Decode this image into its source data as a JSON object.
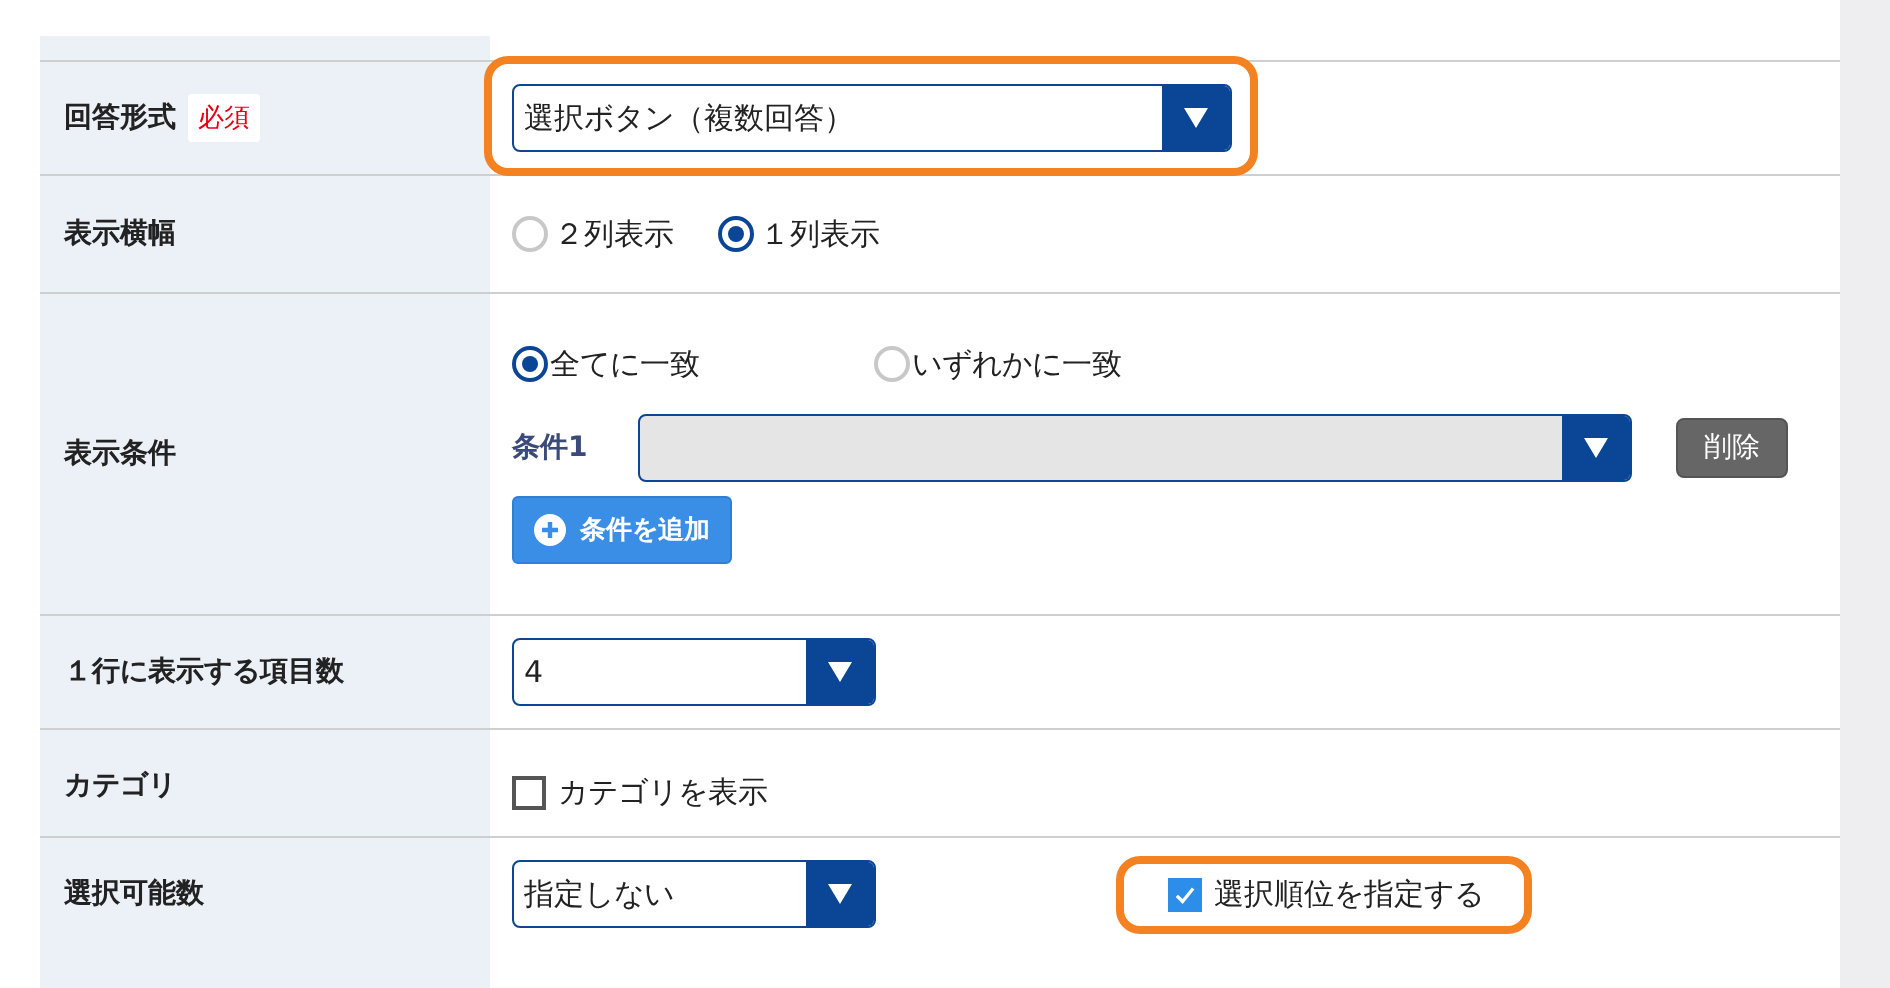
{
  "rows": [
    {
      "kind": "wide-select",
      "label": "回答形式",
      "required": "必須",
      "value": "選択ボタン（複数回答）",
      "highlighted": true
    },
    {
      "kind": "radios",
      "label": "表示横幅",
      "options": [
        {
          "label": "２列表示",
          "selected": false
        },
        {
          "label": "１列表示",
          "selected": true
        }
      ]
    },
    {
      "kind": "conditions",
      "label": "表示条件",
      "options": [
        {
          "label": "全てに一致",
          "selected": true
        },
        {
          "label": "いずれかに一致",
          "selected": false
        }
      ],
      "conditions": [
        {
          "label": "条件1",
          "delete_button": "削除"
        }
      ],
      "add_button": "条件を追加"
    },
    {
      "kind": "select",
      "label": "１行に表示する項目数",
      "value": "4"
    },
    {
      "kind": "checkbox",
      "label": "カテゴリ",
      "checkbox": {
        "label": "カテゴリを表示",
        "checked": false
      }
    },
    {
      "kind": "select-checkbox",
      "label": "選択可能数",
      "value": "指定しない",
      "checkbox": {
        "label": "選択順位を指定する",
        "checked": true,
        "highlighted": true
      }
    }
  ]
}
